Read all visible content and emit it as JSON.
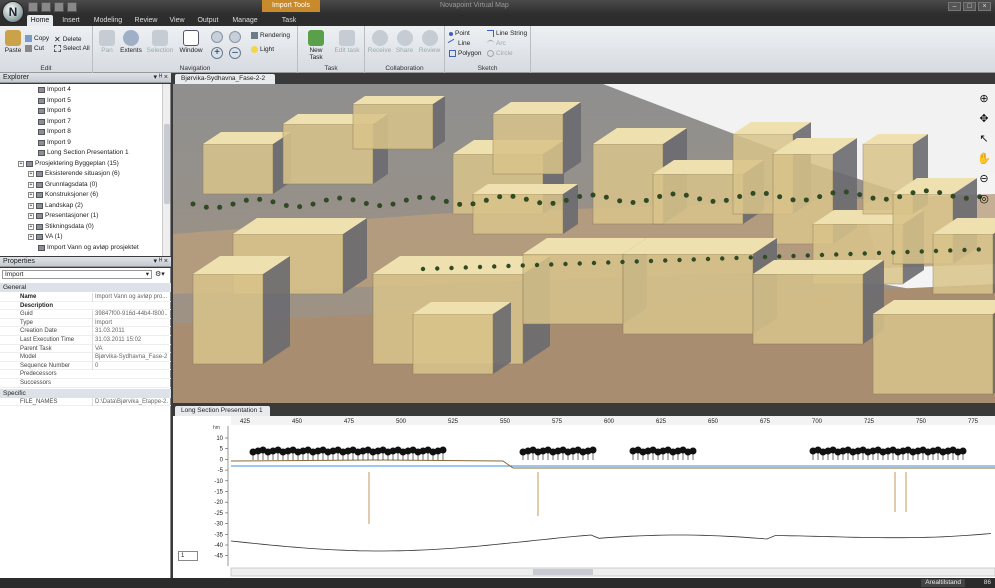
{
  "app": {
    "logo_letter": "N",
    "window_title": "Novapoint Virtual Map",
    "context_tab": "Import Tools"
  },
  "ribbon_tabs": [
    "Home",
    "Insert",
    "Modeling",
    "Review",
    "View",
    "Output",
    "Manage",
    "Task"
  ],
  "ribbon": {
    "edit": {
      "name": "Edit",
      "paste": "Paste",
      "copy": "Copy",
      "cut": "Cut",
      "delete": "Delete",
      "select_all": "Select All"
    },
    "navigation": {
      "name": "Navigation",
      "pan": "Pan",
      "extents": "Extents",
      "selection": "Selection",
      "window": "Window",
      "rendering": "Rendering",
      "light": "Light"
    },
    "task": {
      "name": "Task",
      "new_task": "New Task",
      "edit_task": "Edit task"
    },
    "collaboration": {
      "name": "Collaboration",
      "receive": "Receive",
      "share": "Share",
      "review": "Review"
    },
    "sketch": {
      "name": "Sketch",
      "point": "Point",
      "line": "Line",
      "polygon": "Polygon",
      "line_string": "Line String",
      "arc": "Arc",
      "circle": "Circle"
    }
  },
  "explorer": {
    "title": "Explorer",
    "items": [
      {
        "label": "Import 4",
        "depth": 3
      },
      {
        "label": "Import 5",
        "depth": 3
      },
      {
        "label": "Import 6",
        "depth": 3
      },
      {
        "label": "Import 7",
        "depth": 3
      },
      {
        "label": "Import 8",
        "depth": 3
      },
      {
        "label": "Import 9",
        "depth": 3
      },
      {
        "label": "Long Section Presentation 1",
        "depth": 3
      },
      {
        "label": "Prosjektering Byggeplan (15)",
        "depth": 1
      },
      {
        "label": "Eksisterende situasjon (6)",
        "depth": 2
      },
      {
        "label": "Grunnlagsdata (0)",
        "depth": 2
      },
      {
        "label": "Konstruksjoner (6)",
        "depth": 2
      },
      {
        "label": "Landskap (2)",
        "depth": 2
      },
      {
        "label": "Presentasjoner (1)",
        "depth": 2
      },
      {
        "label": "Stikningsdata (0)",
        "depth": 2
      },
      {
        "label": "VA (1)",
        "depth": 2
      },
      {
        "label": "Import Vann og avløp prosjektet",
        "depth": 3
      }
    ]
  },
  "properties": {
    "title": "Properties",
    "selected": "Import",
    "cat_general": "General",
    "cat_specific": "Specific",
    "rows": [
      {
        "k": "Name",
        "v": "Import Vann og avløp pro...",
        "bold": true
      },
      {
        "k": "Description",
        "v": "",
        "bold": true
      },
      {
        "k": "Guid",
        "v": "39847f00-916d-44b4-f800...",
        "bold": false
      },
      {
        "k": "Type",
        "v": "Import",
        "bold": false
      },
      {
        "k": "Creation Date",
        "v": "31.03.2011",
        "bold": false
      },
      {
        "k": "Last Execution Time",
        "v": "31.03.2011 15:02",
        "bold": false
      },
      {
        "k": "Parent Task",
        "v": "VA",
        "bold": false
      },
      {
        "k": "Model",
        "v": "Bjørvika-Sydhavna_Fase-2",
        "bold": false
      },
      {
        "k": "Sequence Number",
        "v": "0",
        "bold": false
      },
      {
        "k": "Predecessors",
        "v": "",
        "bold": false
      },
      {
        "k": "Successors",
        "v": "",
        "bold": false
      }
    ],
    "specific_rows": [
      {
        "k": "FILE_NAMES",
        "v": "D:\\Data\\Bjørvika_Etappe-2..."
      }
    ]
  },
  "viewport": {
    "tab": "Bjørvika-Sydhavna_Fase-2-2"
  },
  "long_section": {
    "tab": "Long Section Presentation 1",
    "x_ticks": [
      "425",
      "450",
      "475",
      "500",
      "525",
      "550",
      "575",
      "600",
      "625",
      "650",
      "675",
      "700",
      "725",
      "750",
      "775"
    ],
    "y_ticks": [
      "10",
      "5",
      "0",
      "-5",
      "-10",
      "-15",
      "-20",
      "-25",
      "-30",
      "-35",
      "-40",
      "-45"
    ],
    "y_top_label": "hm",
    "page": "1"
  },
  "status": {
    "text": "Arealtilstand",
    "zoom": "86"
  },
  "colors": {
    "building": "#d9c48a",
    "building_dark": "#6a6a70",
    "ground": "#b9a58e",
    "tree": "#2f4a25",
    "accent": "#c98a2c"
  }
}
